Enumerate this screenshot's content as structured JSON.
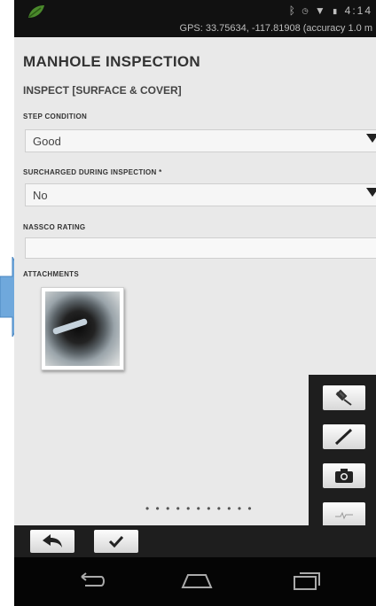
{
  "status_bar": {
    "time": "4:14",
    "gps_text": "GPS: 33.75634, -117.81908 (accuracy 1.0 m"
  },
  "form": {
    "title": "MANHOLE INSPECTION",
    "section": "INSPECT [SURFACE & COVER]",
    "fields": [
      {
        "label": "STEP CONDITION",
        "value": "Good"
      },
      {
        "label": "SURCHARGED DURING INSPECTION *",
        "value": "No"
      },
      {
        "label": "NASSCO RATING",
        "value": ""
      }
    ],
    "attachments_label": "ATTACHMENTS"
  },
  "pager_dots": "• • • • • • • • • • •",
  "colors": {
    "background": "#e9e9e9",
    "dark_bar": "#1e1e1e",
    "highlight_arrow": "#6fa8dc"
  },
  "icons": {
    "tools": [
      "satellite-icon",
      "pencil-icon",
      "camera-icon",
      "signature-icon"
    ],
    "bottom": [
      "back-arrow-icon",
      "checkmark-icon",
      "grid-menu-icon"
    ],
    "nav": [
      "nav-back-icon",
      "nav-home-icon",
      "nav-recents-icon"
    ]
  }
}
